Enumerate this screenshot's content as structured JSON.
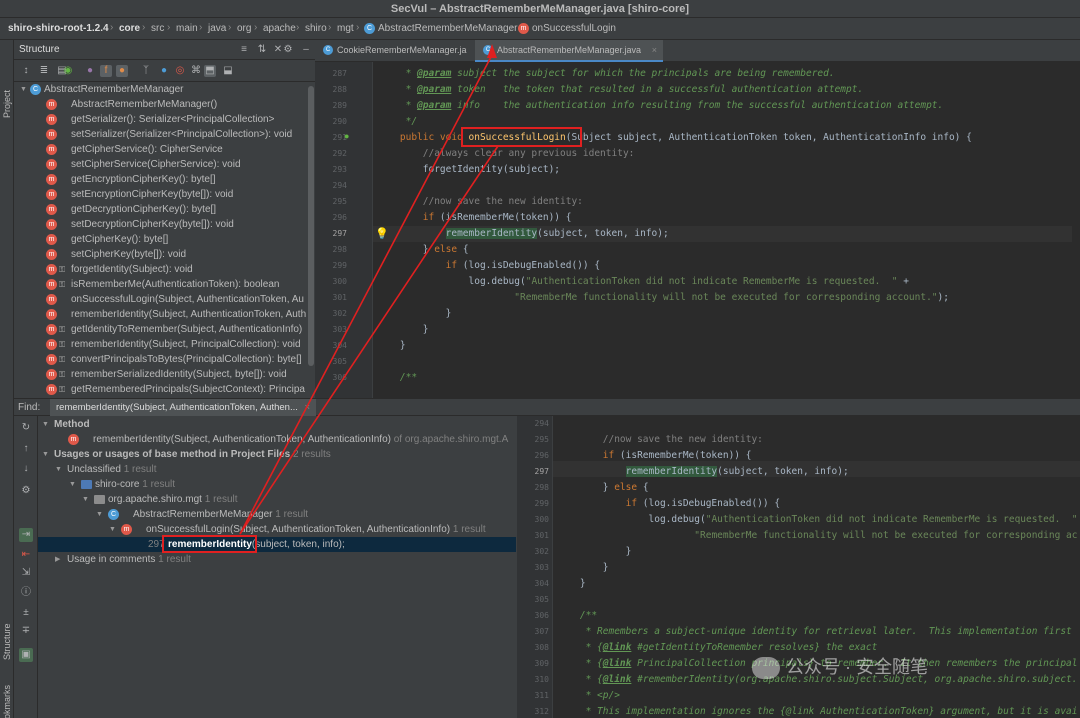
{
  "title": "SecVul – AbstractRememberMeManager.java [shiro-core]",
  "breadcrumbs": [
    "shiro-shiro-root-1.2.4",
    "core",
    "src",
    "main",
    "java",
    "org",
    "apache",
    "shiro",
    "mgt",
    "AbstractRememberMeManager",
    "onSuccessfulLogin"
  ],
  "left_strip": {
    "project": "Project",
    "structure": "Structure",
    "bookmarks": "Bookmarks"
  },
  "structure": {
    "title": "Structure",
    "class_name": "AbstractRememberMeManager",
    "items": [
      "AbstractRememberMeManager()",
      "getSerializer(): Serializer<PrincipalCollection>",
      "setSerializer(Serializer<PrincipalCollection>): void",
      "getCipherService(): CipherService",
      "setCipherService(CipherService): void",
      "getEncryptionCipherKey(): byte[]",
      "setEncryptionCipherKey(byte[]): void",
      "getDecryptionCipherKey(): byte[]",
      "setDecryptionCipherKey(byte[]): void",
      "getCipherKey(): byte[]",
      "setCipherKey(byte[]): void",
      "forgetIdentity(Subject): void",
      "isRememberMe(AuthenticationToken): boolean",
      "onSuccessfulLogin(Subject, AuthenticationToken, Au",
      "rememberIdentity(Subject, AuthenticationToken, Auth",
      "getIdentityToRemember(Subject, AuthenticationInfo)",
      "rememberIdentity(Subject, PrincipalCollection): void",
      "convertPrincipalsToBytes(PrincipalCollection): byte[]",
      "rememberSerializedIdentity(Subject, byte[]): void",
      "getRememberedPrincipals(SubjectContext): Principa"
    ]
  },
  "editor": {
    "tabs": [
      {
        "label": "CookieRememberMeManager.ja",
        "active": false
      },
      {
        "label": "AbstractRememberMeManager.java",
        "active": true
      }
    ],
    "line_numbers": [
      "287",
      "288",
      "289",
      "290",
      "291",
      "292",
      "293",
      "294",
      "295",
      "296",
      "297",
      "298",
      "299",
      "300",
      "301",
      "302",
      "303",
      "304",
      "305",
      "306"
    ],
    "current_line": "297",
    "lines": [
      {
        "doc": "     * ",
        "tag": "@param",
        "rest": " subject the subject for which the principals are being remembered."
      },
      {
        "doc": "     * ",
        "tag": "@param",
        "rest": " token   the token that resulted in a successful authentication attempt."
      },
      {
        "doc": "     * ",
        "tag": "@param",
        "rest": " info    the authentication info resulting from the successful authentication attempt."
      },
      {
        "doc": "     */",
        "tag": "",
        "rest": ""
      },
      {
        "kw": "    public void ",
        "fn": "onSuccessfulLogin",
        "rest": "(Subject subject, AuthenticationToken token, AuthenticationInfo info) {"
      },
      {
        "cm": "        //always clear any previous identity:"
      },
      {
        "plain": "        forgetIdentity(subject);"
      },
      {
        "plain": ""
      },
      {
        "cm": "        //now save the new identity:"
      },
      {
        "kw": "        if ",
        "rest": "(isRememberMe(token)) {"
      },
      {
        "pre": "            ",
        "hl": "rememberIdentity",
        "rest": "(subject, token, info);"
      },
      {
        "plain": "        } ",
        "kw2": "else",
        "rest": " {"
      },
      {
        "kw": "            if ",
        "rest": "(log.isDebugEnabled()) {"
      },
      {
        "pre": "                log.debug(",
        "str": "\"AuthenticationToken did not indicate RememberMe is requested.  \"",
        "rest": " +"
      },
      {
        "pre": "                        ",
        "str": "\"RememberMe functionality will not be executed for corresponding account.\"",
        "rest": ");"
      },
      {
        "plain": "            }"
      },
      {
        "plain": "        }"
      },
      {
        "plain": "    }"
      },
      {
        "plain": ""
      },
      {
        "doc": "    /**",
        "tag": "",
        "rest": ""
      }
    ]
  },
  "find": {
    "label": "Find:",
    "tab": "rememberIdentity(Subject, AuthenticationToken, Authen...",
    "method_header": "Method",
    "method_item": "rememberIdentity(Subject, AuthenticationToken, AuthenticationInfo)",
    "method_item_suffix": "of org.apache.shiro.mgt.A",
    "usages_header": "Usages or usages of base method in Project Files",
    "usages_count": "2 results",
    "unclassified": "Unclassified",
    "unclassified_count": "1 result",
    "module": "shiro-core",
    "module_count": "1 result",
    "package": "org.apache.shiro.mgt",
    "package_count": "1 result",
    "class": "AbstractRememberMeManager",
    "class_count": "1 result",
    "method": "onSuccessfulLogin(Subject, AuthenticationToken, AuthenticationInfo)",
    "method_count": "1 result",
    "usage_line": "297",
    "usage_match": "rememberIdentity",
    "usage_rest": "(subject, token, info);",
    "comments": "Usage in comments",
    "comments_count": "1 result"
  },
  "preview": {
    "line_numbers": [
      "294",
      "295",
      "296",
      "297",
      "298",
      "299",
      "300",
      "301",
      "302",
      "303",
      "304",
      "305",
      "306",
      "307",
      "308",
      "309",
      "310",
      "311",
      "312"
    ],
    "current_line": "297",
    "lines": [
      {
        "plain": ""
      },
      {
        "cm": "        //now save the new identity:"
      },
      {
        "kw": "        if ",
        "rest": "(isRememberMe(token)) {"
      },
      {
        "pre": "            ",
        "hl": "rememberIdentity",
        "rest": "(subject, token, info);"
      },
      {
        "plain": "        } ",
        "kw2": "else",
        "rest": " {"
      },
      {
        "kw": "            if ",
        "rest": "(log.isDebugEnabled()) {"
      },
      {
        "pre": "                log.debug(",
        "str": "\"AuthenticationToken did not indicate RememberMe is requested.  \"",
        "rest": ""
      },
      {
        "pre": "                        ",
        "str": "\"RememberMe functionality will not be executed for corresponding ac",
        "rest": ""
      },
      {
        "plain": "            }"
      },
      {
        "plain": "        }"
      },
      {
        "plain": "    }"
      },
      {
        "plain": ""
      },
      {
        "doc": "    /**",
        "tag": "",
        "rest": ""
      },
      {
        "doc": "     * Remembers a subject-unique identity for retrieval later.  This implementation first",
        "tag": "",
        "rest": ""
      },
      {
        "doc": "     * {",
        "tag": "@link",
        "rest": " #getIdentityToRemember resolves} the exact"
      },
      {
        "doc": "     * {",
        "tag": "@link",
        "rest": " PrincipalCollection principals} to remember.  It then remembers the principal"
      },
      {
        "doc": "     * {",
        "tag": "@link",
        "rest": " #rememberIdentity(org.apache.shiro.subject.Subject, org.apache.shiro.subject."
      },
      {
        "doc": "     * <p/>",
        "tag": "",
        "rest": ""
      },
      {
        "doc": "     * This implementation ignores the {@link AuthenticationToken} argument, but it is avai",
        "tag": "",
        "rest": ""
      }
    ]
  },
  "watermark": "公众号 · 安全随笔",
  "colors": {
    "annotation_red": "#e02020",
    "method_icon": "#e0594a",
    "class_icon": "#4d9cd6"
  }
}
